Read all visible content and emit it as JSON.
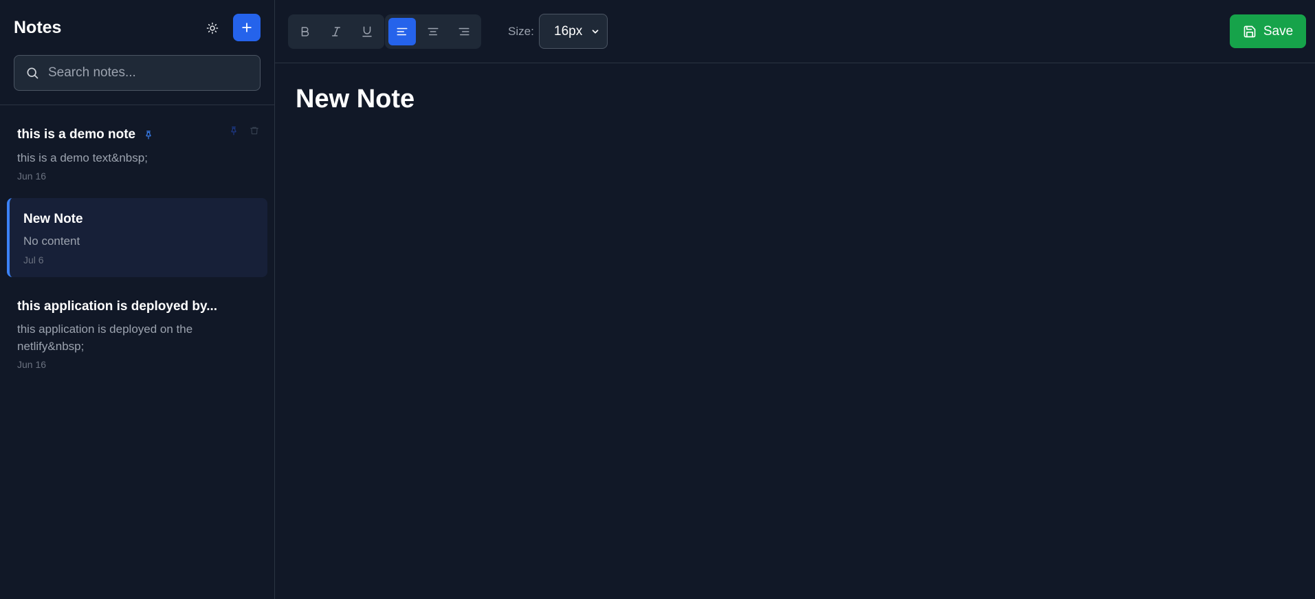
{
  "sidebar": {
    "title": "Notes",
    "theme_icon": "sun-icon",
    "add_icon": "plus-icon",
    "search": {
      "placeholder": "Search notes...",
      "value": "",
      "icon": "search-icon"
    },
    "notes": [
      {
        "title": "this is a demo note",
        "preview": "this is a demo text&nbsp;",
        "date": "Jun 16",
        "pinned": true,
        "active": false
      },
      {
        "title": "New Note",
        "preview": "No content",
        "date": "Jul 6",
        "pinned": false,
        "active": true
      },
      {
        "title": "this application is deployed by...",
        "preview": "this application is deployed on the netlify&nbsp;",
        "date": "Jun 16",
        "pinned": false,
        "active": false
      }
    ]
  },
  "toolbar": {
    "format_buttons": [
      {
        "label": "B",
        "name": "bold"
      },
      {
        "label": "I",
        "name": "italic"
      },
      {
        "label": "U",
        "name": "underline"
      }
    ],
    "align_buttons": [
      {
        "name": "align-left",
        "active": true
      },
      {
        "name": "align-center",
        "active": false
      },
      {
        "name": "align-right",
        "active": false
      }
    ],
    "size_label": "Size:",
    "size_value": "16px",
    "save_label": "Save"
  },
  "editor": {
    "title": "New Note"
  },
  "colors": {
    "background": "#111827",
    "accent": "#2563eb",
    "save": "#16a34a",
    "active_note_bg": "#172038",
    "pin": "#3b82f6"
  }
}
